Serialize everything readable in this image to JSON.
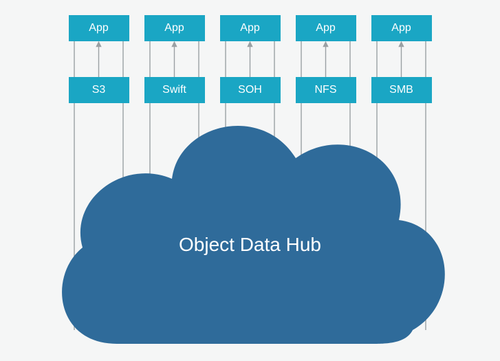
{
  "apps": [
    {
      "label": "App"
    },
    {
      "label": "App"
    },
    {
      "label": "App"
    },
    {
      "label": "App"
    },
    {
      "label": "App"
    }
  ],
  "protocols": [
    {
      "label": "S3"
    },
    {
      "label": "Swift"
    },
    {
      "label": "SOH"
    },
    {
      "label": "NFS"
    },
    {
      "label": "SMB"
    }
  ],
  "hub": {
    "label": "Object Data Hub"
  },
  "colors": {
    "box": "#1aa6c4",
    "cloud": "#2f6b9a",
    "line": "#9aa0a3",
    "bg": "#f5f6f6"
  }
}
